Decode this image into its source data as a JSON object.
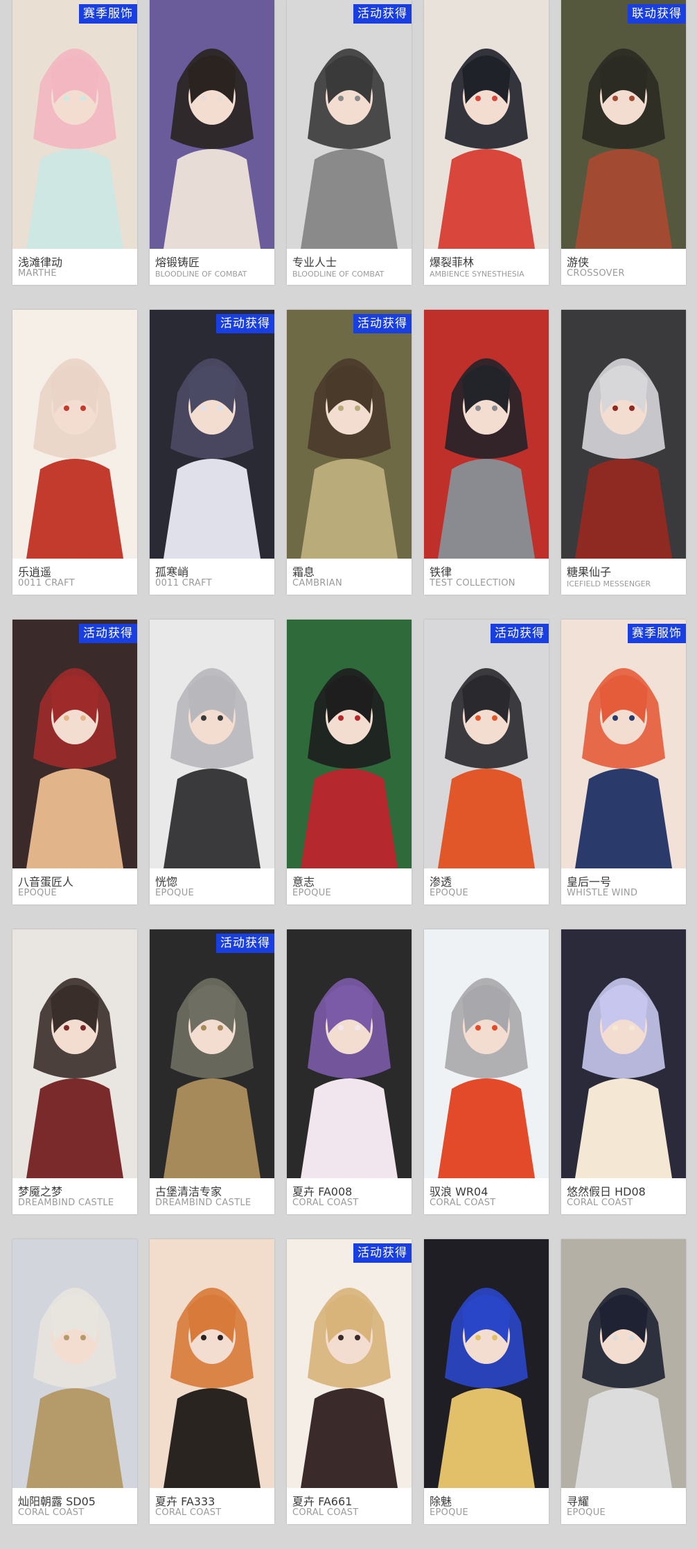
{
  "colors": {
    "badge_bg": "#1a3fe0",
    "page_bg": "#d6d6d6",
    "card_bg": "#ffffff",
    "name_text": "#3a3a3a",
    "series_text": "#9a9a9a"
  },
  "skins": [
    {
      "name": "浅滩律动",
      "series": "MARTHE",
      "badge": "赛季服饰",
      "palette": [
        "#f3b7c2",
        "#cfe7e3",
        "#e9dfd2"
      ],
      "icon": "skin-art-icon"
    },
    {
      "name": "熔锻铸匠",
      "series": "BLOODLINE OF COMBAT",
      "badge": "",
      "palette": [
        "#2a2320",
        "#e7ddd6",
        "#6a5b9a"
      ],
      "icon": "skin-art-icon"
    },
    {
      "name": "专业人士",
      "series": "BLOODLINE OF COMBAT",
      "badge": "活动获得",
      "palette": [
        "#3a3a3a",
        "#8a8a8a",
        "#d8d8d8"
      ],
      "icon": "skin-art-icon"
    },
    {
      "name": "爆裂菲林",
      "series": "AMBIENCE SYNESTHESIA",
      "badge": "",
      "palette": [
        "#20222a",
        "#d9473c",
        "#e8e2da"
      ],
      "icon": "skin-art-icon"
    },
    {
      "name": "游侠",
      "series": "CROSSOVER",
      "badge": "联动获得",
      "palette": [
        "#2b2b24",
        "#a24a32",
        "#55583c"
      ],
      "icon": "skin-art-icon"
    },
    {
      "name": "乐逍遥",
      "series": "0011 CRAFT",
      "badge": "",
      "palette": [
        "#e9d4c7",
        "#c23b2d",
        "#f5efe7"
      ],
      "icon": "skin-art-icon"
    },
    {
      "name": "孤寒峭",
      "series": "0011 CRAFT",
      "badge": "活动获得",
      "palette": [
        "#4b4a64",
        "#dfe0ea",
        "#2a2a34"
      ],
      "icon": "skin-art-icon"
    },
    {
      "name": "霜息",
      "series": "CAMBRIAN",
      "badge": "活动获得",
      "palette": [
        "#4a3a2a",
        "#b9ab7a",
        "#6e6a45"
      ],
      "icon": "skin-art-icon"
    },
    {
      "name": "铁律",
      "series": "TEST COLLECTION",
      "badge": "",
      "palette": [
        "#23242a",
        "#8a8b90",
        "#c0302b"
      ],
      "icon": "skin-art-icon"
    },
    {
      "name": "糖果仙子",
      "series": "ICEFIELD MESSENGER",
      "badge": "",
      "palette": [
        "#d7d7da",
        "#8e2a22",
        "#3a3a3c"
      ],
      "icon": "skin-art-icon"
    },
    {
      "name": "八音蛋匠人",
      "series": "EPOQUE",
      "badge": "活动获得",
      "palette": [
        "#9e2a2a",
        "#e2b48a",
        "#3a2a2a"
      ],
      "icon": "skin-art-icon"
    },
    {
      "name": "恍惚",
      "series": "EPOQUE",
      "badge": "",
      "palette": [
        "#b8b8bc",
        "#3a3a3c",
        "#e9e9ea"
      ],
      "icon": "skin-art-icon"
    },
    {
      "name": "意志",
      "series": "EPOQUE",
      "badge": "",
      "palette": [
        "#1e1e1e",
        "#b4282e",
        "#2f6a3a"
      ],
      "icon": "skin-art-icon"
    },
    {
      "name": "渗透",
      "series": "EPOQUE",
      "badge": "活动获得",
      "palette": [
        "#2a2a2e",
        "#e2572a",
        "#d8d8da"
      ],
      "icon": "skin-art-icon"
    },
    {
      "name": "皇后一号",
      "series": "WHISTLE WIND",
      "badge": "赛季服饰",
      "palette": [
        "#e45c3a",
        "#2a3a6a",
        "#f2e1d6"
      ],
      "icon": "skin-art-icon"
    },
    {
      "name": "梦魇之梦",
      "series": "DREAMBIND CASTLE",
      "badge": "",
      "palette": [
        "#3a2e2a",
        "#7a2a2a",
        "#e9e6e2"
      ],
      "icon": "skin-art-icon"
    },
    {
      "name": "古堡清洁专家",
      "series": "DREAMBIND CASTLE",
      "badge": "活动获得",
      "palette": [
        "#6e6e62",
        "#a68a5a",
        "#2a2a2a"
      ],
      "icon": "skin-art-icon"
    },
    {
      "name": "夏卉 FA008",
      "series": "CORAL COAST",
      "badge": "",
      "palette": [
        "#7b5aa8",
        "#f1e6ee",
        "#2a2a2a"
      ],
      "icon": "skin-art-icon"
    },
    {
      "name": "驭浪 WR04",
      "series": "CORAL COAST",
      "badge": "",
      "palette": [
        "#a8a8ac",
        "#e24a2a",
        "#eef2f4"
      ],
      "icon": "skin-art-icon"
    },
    {
      "name": "悠然假日 HD08",
      "series": "CORAL COAST",
      "badge": "",
      "palette": [
        "#c6c6ee",
        "#f4e8d4",
        "#2a2a3a"
      ],
      "icon": "skin-art-icon"
    },
    {
      "name": "灿阳朝露 SD05",
      "series": "CORAL COAST",
      "badge": "",
      "palette": [
        "#e8e4de",
        "#b59a6a",
        "#d2d6dc"
      ],
      "icon": "skin-art-icon"
    },
    {
      "name": "夏卉 FA333",
      "series": "CORAL COAST",
      "badge": "",
      "palette": [
        "#d77a3a",
        "#2a2420",
        "#f2dccb"
      ],
      "icon": "skin-art-icon"
    },
    {
      "name": "夏卉 FA661",
      "series": "CORAL COAST",
      "badge": "活动获得",
      "palette": [
        "#d8b37a",
        "#3a2a2a",
        "#f4eee6"
      ],
      "icon": "skin-art-icon"
    },
    {
      "name": "除魅",
      "series": "EPOQUE",
      "badge": "",
      "palette": [
        "#2a46c8",
        "#e2c06a",
        "#1e1e24"
      ],
      "icon": "skin-art-icon"
    },
    {
      "name": "寻耀",
      "series": "EPOQUE",
      "badge": "",
      "palette": [
        "#1e2232",
        "#dcdcdc",
        "#b4b0a6"
      ],
      "icon": "skin-art-icon"
    }
  ]
}
